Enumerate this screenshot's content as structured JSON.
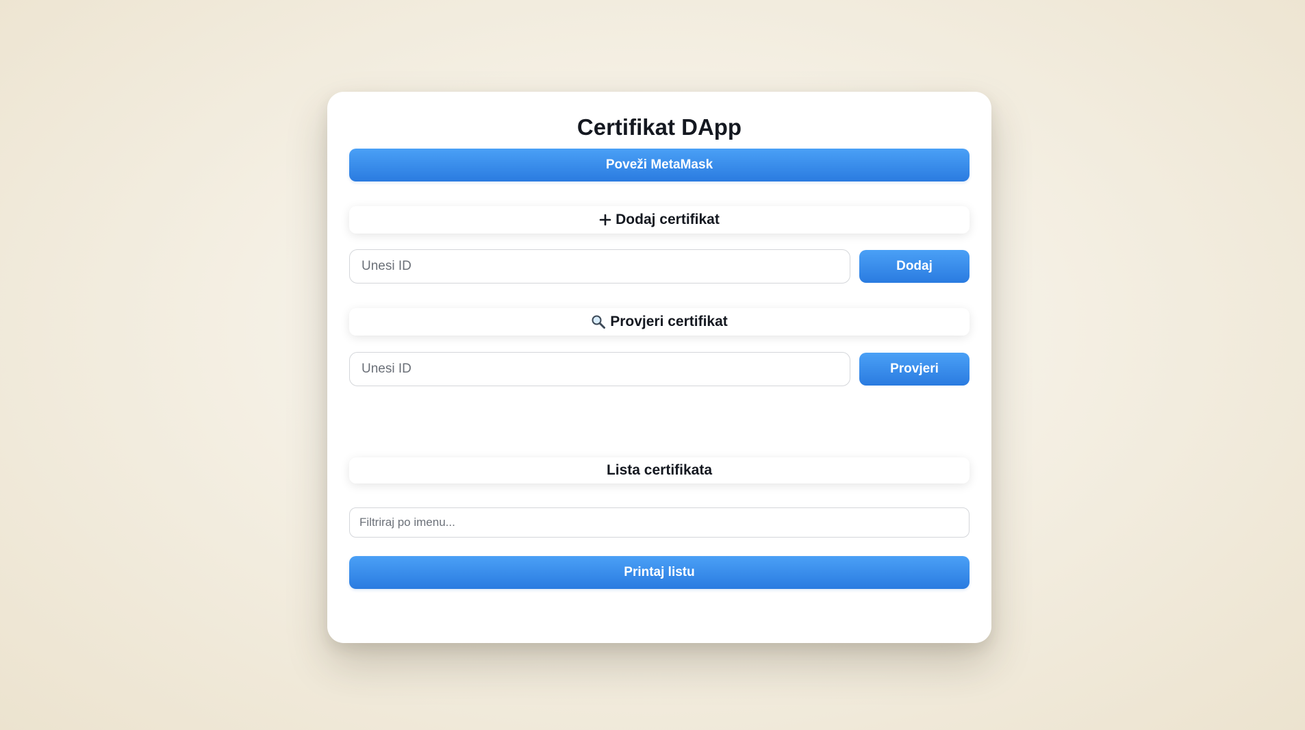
{
  "app": {
    "title": "Certifikat DApp",
    "connect_label": "Poveži MetaMask"
  },
  "add_section": {
    "icon": "plus-icon",
    "title": "Dodaj certifikat",
    "input_placeholder": "Unesi ID",
    "button_label": "Dodaj"
  },
  "verify_section": {
    "icon": "magnifier-icon",
    "title": "Provjeri certifikat",
    "input_placeholder": "Unesi ID",
    "button_label": "Provjeri"
  },
  "list_section": {
    "title": "Lista certifikata",
    "filter_placeholder": "Filtriraj po imenu...",
    "print_label": "Printaj listu"
  },
  "colors": {
    "accent": "#2a7be0",
    "accent_light": "#4aa0f6",
    "text": "#141820"
  }
}
